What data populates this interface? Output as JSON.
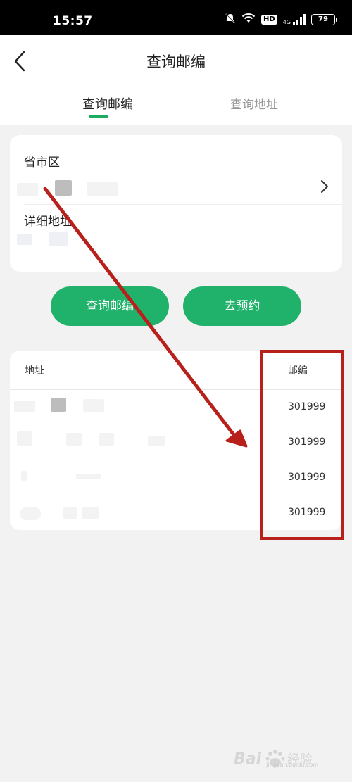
{
  "status_bar": {
    "time": "15:57",
    "hd_badge": "HD",
    "network": "4G",
    "battery": "79"
  },
  "header": {
    "title": "查询邮编",
    "back_icon": "chevron-left-icon",
    "tabs": [
      {
        "label": "查询邮编",
        "active": true
      },
      {
        "label": "查询地址",
        "active": false
      }
    ],
    "accent_color": "#1aad62"
  },
  "form": {
    "region_label": "省市区",
    "detail_label": "详细地址",
    "region_value": "",
    "detail_value": ""
  },
  "buttons": {
    "query_label": "查询邮编",
    "reserve_label": "去预约",
    "color": "#20b26b"
  },
  "results": {
    "address_header": "地址",
    "postcode_header": "邮编",
    "rows": [
      {
        "address": "",
        "postcode": "301999"
      },
      {
        "address": "",
        "postcode": "301999"
      },
      {
        "address": "",
        "postcode": "301999"
      },
      {
        "address": "",
        "postcode": "301999"
      }
    ]
  },
  "annotation": {
    "color": "#b8201c"
  },
  "watermark": {
    "text": "Bai",
    "text2": "经验",
    "sub": "jingyan.baidu.com"
  }
}
